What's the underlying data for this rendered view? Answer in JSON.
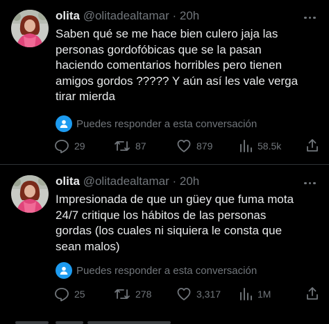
{
  "tweets": [
    {
      "author_name": "olita",
      "handle": "@olitadealtamar",
      "separator": "·",
      "time": "20h",
      "text": "Saben qué se me hace bien culero jaja las\npersonas gordofóbicas que se la pasan\nhaciendo comentarios horribles pero tienen\namigos gordos ????? Y aún así les vale verga\ntirar mierda",
      "reply_notice": "Puedes responder a esta conversación",
      "replies": "29",
      "retweets": "87",
      "likes": "879",
      "views": "58.5k"
    },
    {
      "author_name": "olita",
      "handle": "@olitadealtamar",
      "separator": "·",
      "time": "20h",
      "text": "Impresionada de que un güey que fuma mota\n24/7 critique los hábitos de las personas\ngordas (los cuales ni siquiera le consta que\nsean malos)",
      "reply_notice": "Puedes responder a esta conversación",
      "replies": "25",
      "retweets": "278",
      "likes": "3,317",
      "views": "1M"
    }
  ],
  "colors": {
    "background": "#000000",
    "text": "#e7e9ea",
    "secondary": "#71767b",
    "accent": "#1d9bf0",
    "divider": "#2f3336"
  },
  "icons": {
    "reply": "speech-bubble-icon",
    "retweet": "retweet-arrows-icon",
    "like": "heart-icon",
    "views": "bar-chart-icon",
    "share": "share-arrow-icon",
    "more": "more-dots-icon",
    "reply_notice": "person-icon"
  }
}
